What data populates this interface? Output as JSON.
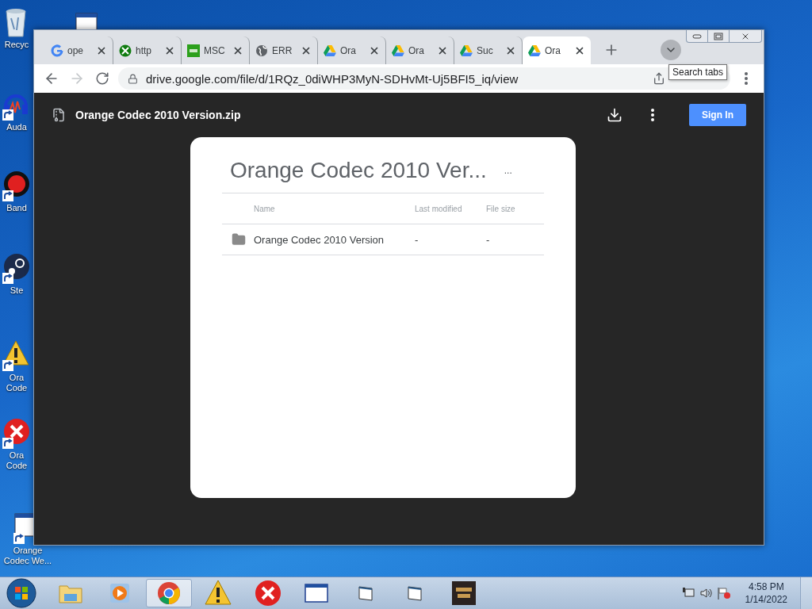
{
  "desktop": {
    "icons": [
      {
        "label": "Recyc",
        "kind": "recycle"
      },
      {
        "kind": "window"
      },
      {
        "label": "Auda",
        "kind": "audio"
      },
      {
        "label": "Band",
        "kind": "record"
      },
      {
        "label": "Ste",
        "kind": "steam"
      },
      {
        "label": "Ora Code",
        "kind": "warning"
      },
      {
        "label": "Ora Code",
        "kind": "error"
      },
      {
        "label": "Orange Codec We...",
        "kind": "window"
      }
    ]
  },
  "browser": {
    "tabs": [
      {
        "title": "ope",
        "kind": "google",
        "selected": false
      },
      {
        "title": "http",
        "kind": "xbox",
        "selected": false
      },
      {
        "title": "MSC",
        "kind": "ocx",
        "selected": false
      },
      {
        "title": "ERR",
        "kind": "globe",
        "selected": false
      },
      {
        "title": "Ora",
        "kind": "drive",
        "selected": false
      },
      {
        "title": "Ora",
        "kind": "drive",
        "selected": false
      },
      {
        "title": "Suc",
        "kind": "drive",
        "selected": false
      },
      {
        "title": "Ora",
        "kind": "drive",
        "selected": true
      }
    ],
    "tooltip": "Search tabs",
    "forward_disabled": true,
    "address": "drive.google.com/file/d/1RQz_0diWHP3MyN-SDHvMt-Uj5BFI5_iq/view"
  },
  "viewer": {
    "file_name": "Orange Codec 2010 Version.zip",
    "sign_in": "Sign In",
    "card": {
      "title": "Orange Codec 2010 Ver...",
      "more": "...",
      "columns": [
        "Name",
        "Last modified",
        "File size"
      ],
      "rows": [
        {
          "kind": "folder",
          "cells": [
            "Orange Codec 2010 Version",
            "-",
            "-"
          ]
        }
      ]
    }
  },
  "taskbar": {
    "items": [
      {
        "kind": "explorer",
        "selected": false
      },
      {
        "kind": "media",
        "selected": false
      },
      {
        "kind": "chrome",
        "selected": true
      },
      {
        "kind": "warning",
        "selected": false
      },
      {
        "kind": "error",
        "selected": false
      },
      {
        "kind": "window",
        "selected": false
      },
      {
        "kind": "smallwindow",
        "selected": false
      },
      {
        "kind": "smallwindow",
        "selected": false
      },
      {
        "kind": "thumbnail",
        "selected": false
      }
    ],
    "time": "4:58 PM",
    "date": "1/14/2022"
  }
}
